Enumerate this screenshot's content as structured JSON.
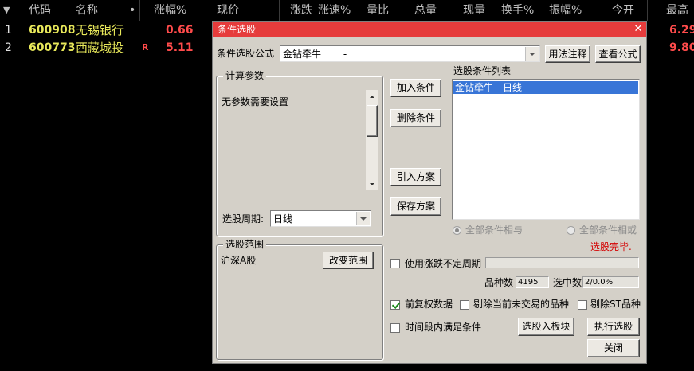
{
  "table": {
    "header": {
      "sort_icon": "▼",
      "code": "代码",
      "name": "名称",
      "dot": "•",
      "change_pct": "涨幅%",
      "price": "现价",
      "change": "涨跌",
      "speed": "涨速%",
      "vol_ratio": "量比",
      "total_vol": "总量",
      "cur_vol": "现量",
      "turnover": "换手%",
      "amplitude": "振幅%",
      "open": "今开",
      "high": "最高"
    },
    "rows": [
      {
        "idx": "1",
        "code": "600908",
        "name": "无锡银行",
        "flag": "",
        "change_pct": "0.66",
        "high": "6.29"
      },
      {
        "idx": "2",
        "code": "600773",
        "name": "西藏城投",
        "flag": "R",
        "change_pct": "5.11",
        "high": "9.80"
      }
    ]
  },
  "dialog": {
    "title": "条件选股",
    "minimize": "—",
    "close": "✕",
    "formula_label": "条件选股公式",
    "formula_value": "金钻牵牛　　 -",
    "usage_button": "用法注释",
    "view_formula_button": "查看公式",
    "params_group": "计算参数",
    "params_text": "无参数需要设置",
    "period_label": "选股周期:",
    "period_value": "日线",
    "add_button": "加入条件",
    "delete_button": "删除条件",
    "import_button": "引入方案",
    "save_button": "保存方案",
    "list_label": "选股条件列表",
    "list_items": [
      "金钻牵牛　日线"
    ],
    "radio_and": "全部条件相与",
    "radio_or": "全部条件相或",
    "status": "选股完毕.",
    "range_group": "选股范围",
    "range_text": "沪深A股",
    "change_range_button": "改变范围",
    "uncertain_period_label": "使用涨跌不定周期",
    "count_label": "品种数",
    "count_value": "4195",
    "selected_label": "选中数",
    "selected_value": "2/0.0%",
    "adjusted_label": "前复权数据",
    "exclude_untraded_label": "剔除当前未交易的品种",
    "exclude_st_label": "剔除ST品种",
    "time_period_label": "时间段内满足条件",
    "to_block_button": "选股入板块",
    "execute_button": "执行选股",
    "close_button": "关闭",
    "colors": {
      "titlebar": "#e63c3c",
      "status": "#d40000",
      "selection": "#3875d7"
    }
  }
}
